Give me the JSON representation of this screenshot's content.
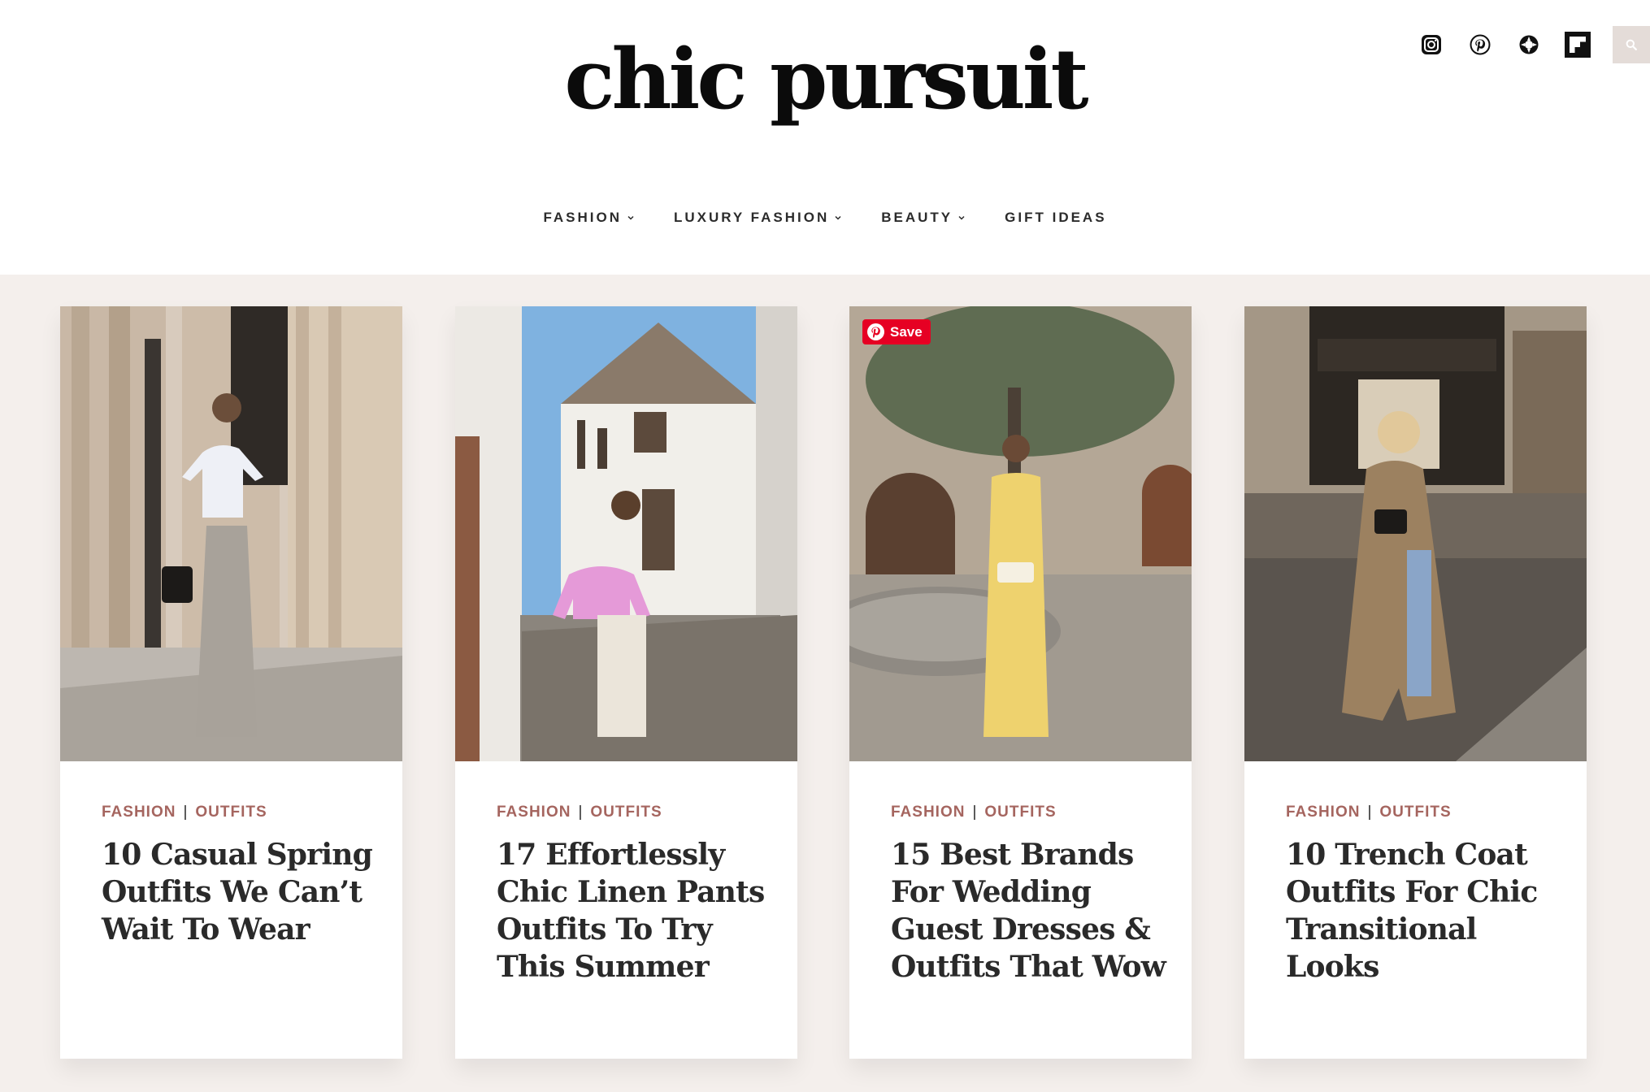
{
  "site": {
    "logo": "chic pursuit"
  },
  "social": {
    "icons": [
      "instagram-icon",
      "pinterest-icon",
      "ltk-icon",
      "flipboard-icon",
      "search-icon"
    ]
  },
  "nav": {
    "items": [
      {
        "label": "FASHION",
        "has_dropdown": true
      },
      {
        "label": "LUXURY FASHION",
        "has_dropdown": true
      },
      {
        "label": "BEAUTY",
        "has_dropdown": true
      },
      {
        "label": "GIFT IDEAS",
        "has_dropdown": false
      }
    ]
  },
  "pin": {
    "save_label": "Save"
  },
  "cards": [
    {
      "cat1": "FASHION",
      "cat2": "OUTFITS",
      "title": "10 Casual Spring Outfits We Can’t Wait To Wear"
    },
    {
      "cat1": "FASHION",
      "cat2": "OUTFITS",
      "title": "17 Effortlessly Chic Linen Pants Outfits To Try This Summer"
    },
    {
      "cat1": "FASHION",
      "cat2": "OUTFITS",
      "title": "15 Best Brands For Wedding Guest Dresses & Outfits That Wow"
    },
    {
      "cat1": "FASHION",
      "cat2": "OUTFITS",
      "title": "10 Trench Coat Outfits For Chic Transitional Looks"
    }
  ],
  "colors": {
    "accent": "#a5655f",
    "background": "#f4efec",
    "pinterest": "#e60023",
    "search_bg": "#e4dcd8"
  }
}
